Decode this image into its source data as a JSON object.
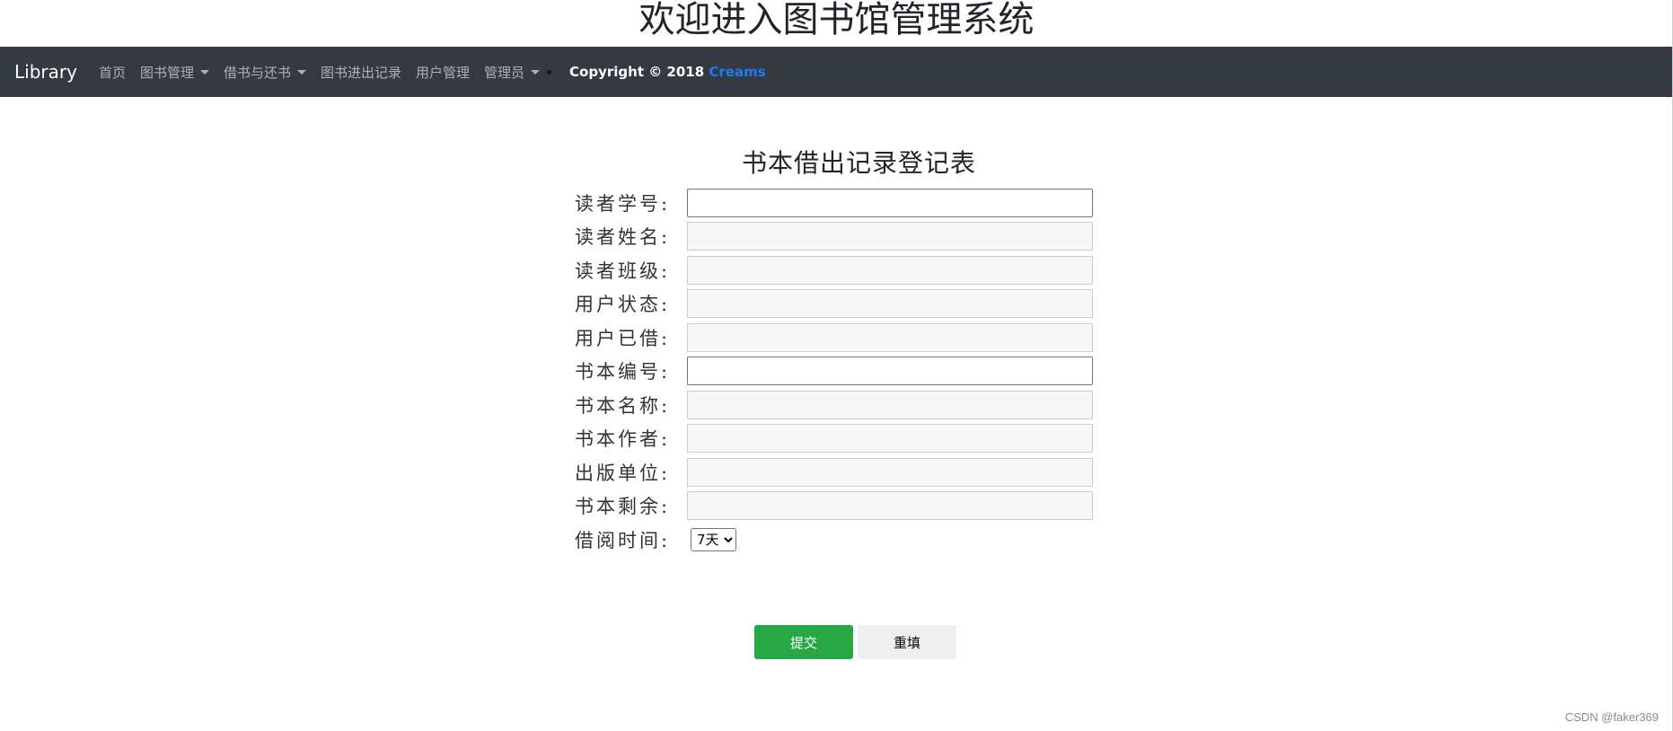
{
  "site_title": "欢迎进入图书馆管理系统",
  "navbar": {
    "brand": "Library",
    "items": [
      {
        "label": "首页",
        "dropdown": false
      },
      {
        "label": "图书管理",
        "dropdown": true
      },
      {
        "label": "借书与还书",
        "dropdown": true
      },
      {
        "label": "图书进出记录",
        "dropdown": false
      },
      {
        "label": "用户管理",
        "dropdown": false
      },
      {
        "label": "管理员",
        "dropdown": true
      }
    ],
    "copyright_prefix": "Copyright © 2018 ",
    "copyright_link": "Creams"
  },
  "form": {
    "title": "书本借出记录登记表",
    "fields": [
      {
        "label": "读者学号:",
        "value": "",
        "editable": true
      },
      {
        "label": "读者姓名:",
        "value": "",
        "editable": false
      },
      {
        "label": "读者班级:",
        "value": "",
        "editable": false
      },
      {
        "label": "用户状态:",
        "value": "",
        "editable": false
      },
      {
        "label": "用户已借:",
        "value": "",
        "editable": false
      },
      {
        "label": "书本编号:",
        "value": "",
        "editable": true
      },
      {
        "label": "书本名称:",
        "value": "",
        "editable": false
      },
      {
        "label": "书本作者:",
        "value": "",
        "editable": false
      },
      {
        "label": "出版单位:",
        "value": "",
        "editable": false
      },
      {
        "label": "书本剩余:",
        "value": "",
        "editable": false
      }
    ],
    "borrow_time_label": "借阅时间:",
    "borrow_time_selected": "7天",
    "submit_label": "提交",
    "reset_label": "重填"
  },
  "watermark": "CSDN @faker369",
  "colors": {
    "navbar_bg": "#343a40",
    "submit_bg": "#28a745",
    "reset_bg": "#efefef",
    "link": "#1e7bf2"
  }
}
